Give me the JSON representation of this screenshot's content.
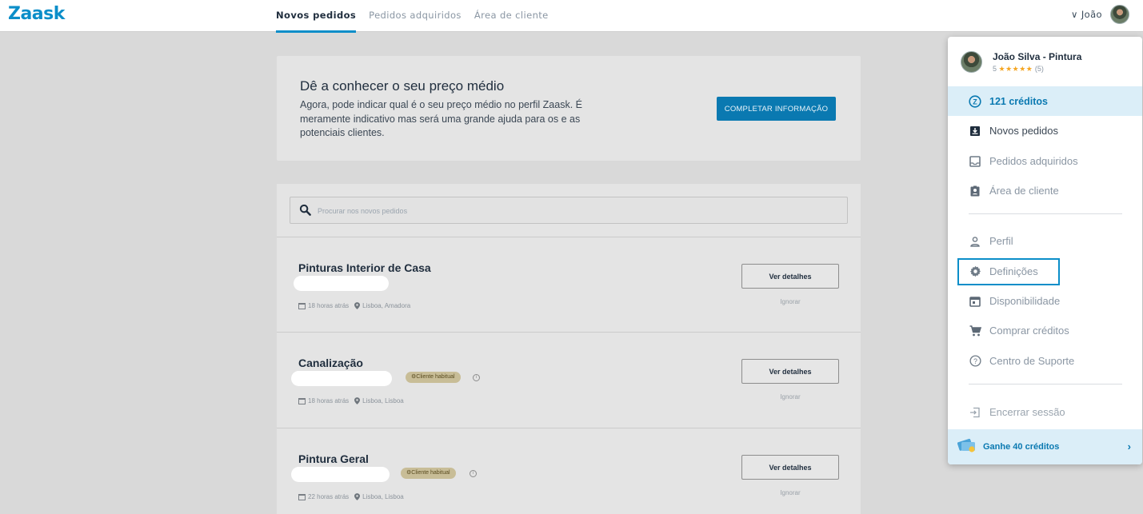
{
  "brand": {
    "logo": "Zaask",
    "accent": "#0b8ec9"
  },
  "nav": {
    "items": [
      {
        "label": "Novos pedidos",
        "active": true
      },
      {
        "label": "Pedidos adquiridos",
        "active": false
      },
      {
        "label": "Área de cliente",
        "active": false
      }
    ],
    "user_label": "João"
  },
  "info": {
    "title": "Dê a conhecer o seu preço médio",
    "text": "Agora, pode indicar qual é o seu preço médio no perfil Zaask. É meramente indicativo mas será uma grande ajuda para os e as potenciais clientes.",
    "button": "COMPLETAR INFORMAÇÃO"
  },
  "search": {
    "placeholder": "Procurar nos novos pedidos"
  },
  "requests": [
    {
      "title": "Pinturas Interior de Casa",
      "badge": "",
      "time": "18 horas atrás",
      "location": "Lisboa, Amadora",
      "details": "Ver detalhes",
      "ignore": "Ignorar"
    },
    {
      "title": "Canalização",
      "badge": "Cliente habitual",
      "time": "18 horas atrás",
      "location": "Lisboa, Lisboa",
      "details": "Ver detalhes",
      "ignore": "Ignorar"
    },
    {
      "title": "Pintura Geral",
      "badge": "Cliente habitual",
      "time": "22 horas atrás",
      "location": "Lisboa, Lisboa",
      "details": "Ver detalhes",
      "ignore": "Ignorar"
    }
  ],
  "dropdown": {
    "name": "João Silva - Pintura",
    "rating_value": "5",
    "stars": "★★★★★",
    "reviews": "(5)",
    "credits": "121 créditos",
    "menu": [
      {
        "label": "Novos pedidos",
        "icon": "inbox-download-icon"
      },
      {
        "label": "Pedidos adquiridos",
        "icon": "inbox-icon"
      },
      {
        "label": "Área de cliente",
        "icon": "badge-icon"
      }
    ],
    "account": [
      {
        "label": "Perfil",
        "icon": "user-icon"
      },
      {
        "label": "Definições",
        "icon": "gear-icon"
      },
      {
        "label": "Disponibilidade",
        "icon": "calendar-icon"
      },
      {
        "label": "Comprar créditos",
        "icon": "cart-icon"
      },
      {
        "label": "Centro de Suporte",
        "icon": "help-icon"
      }
    ],
    "logout": "Encerrar sessão",
    "earn": "Ganhe 40 créditos"
  }
}
